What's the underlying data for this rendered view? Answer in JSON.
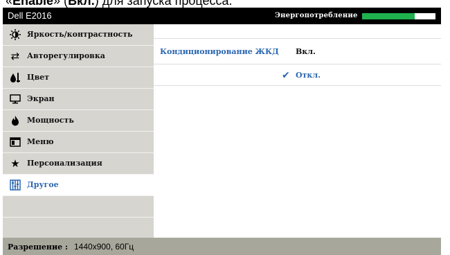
{
  "caption": {
    "prefix": "«",
    "enable": "Enable",
    "mid": "» (",
    "on": "Вкл.",
    "suffix": ") для запуска процесса."
  },
  "header": {
    "model": "Dell E2016",
    "energy_label": "Энергопотребление",
    "energy_level_percent": 72,
    "energy_color": "#1eb14e"
  },
  "sidebar": {
    "items": [
      {
        "label": "Яркость/контрастность",
        "icon": "brightness-icon"
      },
      {
        "label": "Авторегулировка",
        "icon": "auto-adjust-icon"
      },
      {
        "label": "Цвет",
        "icon": "color-icon"
      },
      {
        "label": "Экран",
        "icon": "display-icon"
      },
      {
        "label": "Мощность",
        "icon": "power-icon"
      },
      {
        "label": "Меню",
        "icon": "menu-icon"
      },
      {
        "label": "Персонализация",
        "icon": "star-icon"
      },
      {
        "label": "Другое",
        "icon": "other-icon",
        "active": true
      }
    ]
  },
  "content": {
    "setting_label": "Кондиционирование ЖКД",
    "option_on": "Вкл.",
    "option_off": "Откл.",
    "selected": "Откл."
  },
  "status": {
    "label": "Разрешение :",
    "value": "1440x900, 60Гц"
  },
  "colors": {
    "accent": "#2b66b0",
    "sidebar": "#d6d5d0",
    "statusbar": "#a8a79c"
  }
}
